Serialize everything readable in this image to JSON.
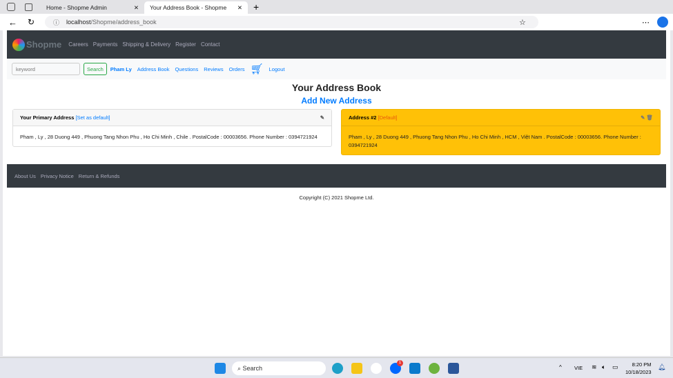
{
  "browser": {
    "tabs": [
      {
        "title": "Home - Shopme Admin"
      },
      {
        "title": "Your Address Book - Shopme"
      }
    ],
    "url_host": "localhost",
    "url_path": "/Shopme/address_book"
  },
  "nav": {
    "brand": "Shopme",
    "links": [
      "Careers",
      "Payments",
      "Shipping & Delivery",
      "Register",
      "Contact"
    ]
  },
  "subnav": {
    "search_placeholder": "keyword",
    "search_label": "Search",
    "user": "Pham Ly",
    "links": [
      "Address Book",
      "Questions",
      "Reviews",
      "Orders"
    ],
    "logout": "Logout"
  },
  "main": {
    "title": "Your Address Book",
    "add_new": "Add New Address",
    "primary": {
      "header": "Your Primary Address",
      "set_default": "[Set as default]",
      "text": "Pham , Ly , 28 Duong 449 , Phuong Tang Nhon Phu , Ho Chi Minh , Chile . PostalCode : 00003656. Phone Number : 0394721924"
    },
    "address2": {
      "header": "Address #2",
      "default": "[Default]",
      "text": "Pham , Ly , 28 Duong 449 , Phuong Tang Nhon Phu , Ho Chi Minh , HCM , Việt Nam . PostalCode : 00003656. Phone Number : 0394721924",
      "color": "#ffc107"
    }
  },
  "footer": {
    "links": [
      "About Us",
      "Privacy Notice",
      "Return & Refunds"
    ],
    "copyright": "Copyright (C) 2021 Shopme Ltd."
  },
  "taskbar": {
    "search": "Search",
    "lang": "VIE",
    "time": "8:20 PM",
    "date": "10/18/2023",
    "badge": "1"
  }
}
